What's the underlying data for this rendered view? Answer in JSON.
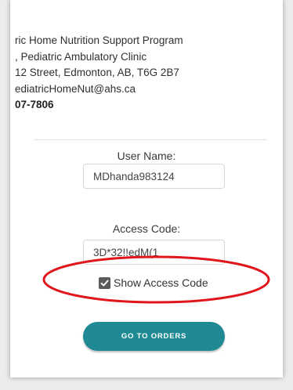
{
  "contact": {
    "line1": "ric Home Nutrition Support Program",
    "line2": ", Pediatric Ambulatory Clinic",
    "line3": "12 Street, Edmonton, AB, T6G 2B7",
    "line4": "ediatricHomeNut@ahs.ca",
    "phone": "07-7806"
  },
  "form": {
    "username_label": "User Name:",
    "username_value": "MDhanda983124",
    "access_code_label": "Access Code:",
    "access_code_value": "3D*32!!edM(1",
    "show_access_code_label": "Show Access Code",
    "show_access_code_checked": true,
    "go_button_label": "GO TO ORDERS"
  },
  "colors": {
    "accent": "#1f8a94",
    "highlight": "#e0161c"
  }
}
